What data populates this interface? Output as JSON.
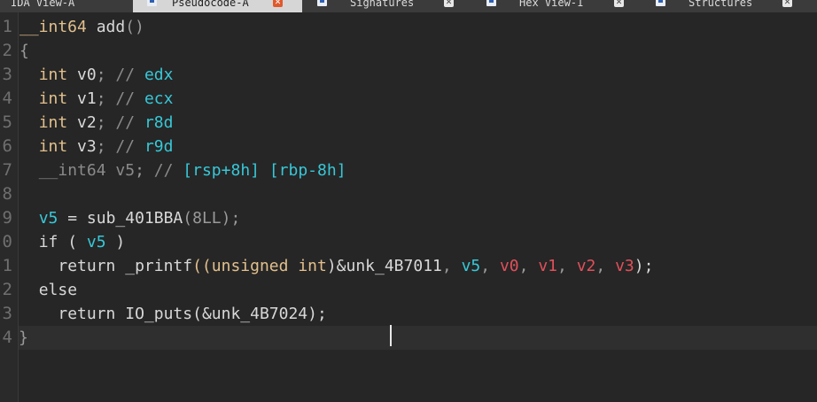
{
  "tabs": [
    {
      "label": "IDA View-A",
      "icon": "disassembly-icon",
      "active": false
    },
    {
      "label": "Pseudocode-A",
      "icon": "pseudocode-icon",
      "active": true
    },
    {
      "label": "Signatures",
      "icon": "signatures-icon",
      "active": false
    },
    {
      "label": "Hex View-1",
      "icon": "hex-view-icon",
      "active": false
    },
    {
      "label": "Structures",
      "icon": "structures-icon",
      "active": false
    }
  ],
  "close_glyph": "✕",
  "line_numbers": [
    "1",
    "2",
    "3",
    "4",
    "5",
    "6",
    "7",
    "8",
    "9",
    "0",
    "1",
    "2",
    "3",
    "4"
  ],
  "code": {
    "l1": {
      "type": "__int64",
      "name": "add",
      "parens": "()"
    },
    "l2": {
      "brace": "{"
    },
    "l3": {
      "type": "int",
      "var": "v0",
      "semi": ";",
      "slashes": "//",
      "reg": "edx"
    },
    "l4": {
      "type": "int",
      "var": "v1",
      "semi": ";",
      "slashes": "//",
      "reg": "ecx"
    },
    "l5": {
      "type": "int",
      "var": "v2",
      "semi": ";",
      "slashes": "//",
      "reg": "r8d"
    },
    "l6": {
      "type": "int",
      "var": "v3",
      "semi": ";",
      "slashes": "//",
      "reg": "r9d"
    },
    "l7": {
      "type": "__int64",
      "var": "v5",
      "semi": ";",
      "slashes": "//",
      "reg": "[rsp+8h] [rbp-8h]"
    },
    "l9": {
      "var": "v5",
      "op": " = ",
      "fn": "sub_401BBA",
      "open": "(",
      "arg": "8LL",
      "close": ");"
    },
    "l10": {
      "kw": "if",
      "open": " ( ",
      "var": "v5",
      "close": " )"
    },
    "l11": {
      "kw": "return",
      "fn": "_printf",
      "open": "((",
      "cast": "unsigned int",
      "mid": ")&unk_4B7011",
      "comma": ", ",
      "a1": "v5",
      "a2": "v0",
      "a3": "v1",
      "a4": "v2",
      "a5": "v3",
      "close": ");"
    },
    "l12": {
      "kw": "else"
    },
    "l13": {
      "kw": "return",
      "fn": "IO_puts",
      "open": "(",
      "arg": "&unk_4B7024",
      "close": ");"
    },
    "l14": {
      "brace": "}"
    }
  }
}
